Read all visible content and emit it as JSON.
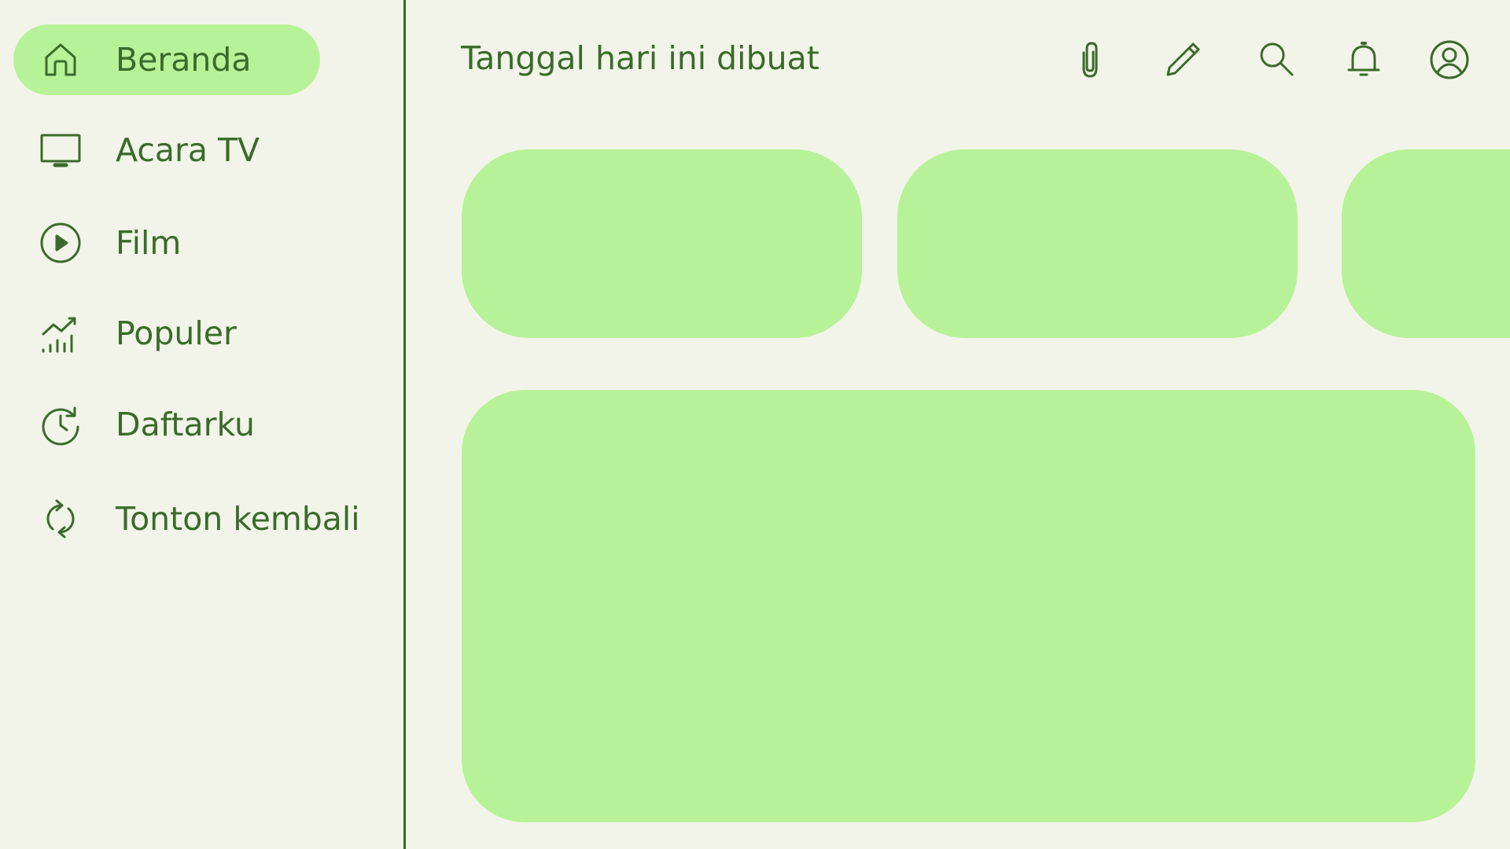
{
  "sidebar": {
    "items": [
      {
        "label": "Beranda",
        "icon": "home-icon",
        "active": true
      },
      {
        "label": "Acara TV",
        "icon": "tv-icon",
        "active": false
      },
      {
        "label": "Film",
        "icon": "play-circle-icon",
        "active": false
      },
      {
        "label": "Populer",
        "icon": "trending-chart-icon",
        "active": false
      },
      {
        "label": "Daftarku",
        "icon": "history-clock-icon",
        "active": false
      },
      {
        "label": "Tonton kembali",
        "icon": "refresh-icon",
        "active": false
      }
    ]
  },
  "header": {
    "title": "Tanggal hari ini dibuat",
    "actions": [
      "paperclip-icon",
      "pencil-icon",
      "search-icon",
      "bell-icon",
      "account-icon"
    ]
  },
  "colors": {
    "background": "#f2f4e9",
    "accent": "#b8f298",
    "foreground": "#3a6b2a"
  }
}
